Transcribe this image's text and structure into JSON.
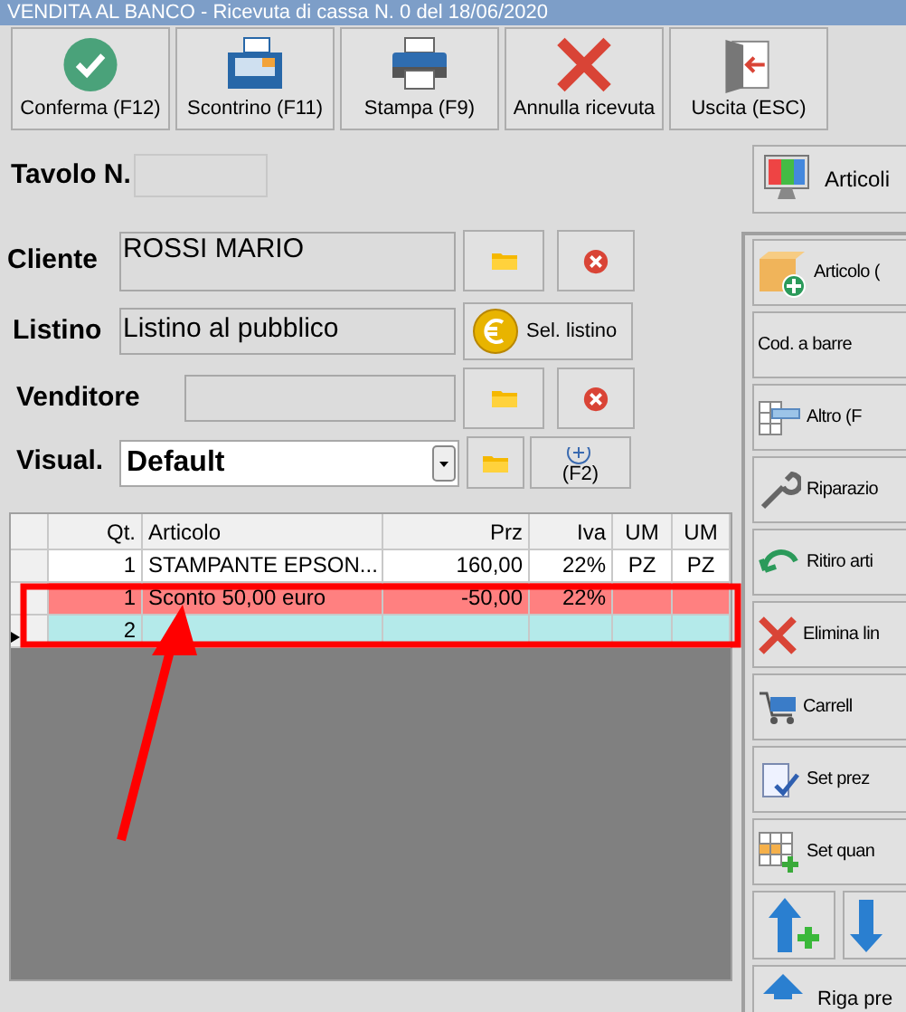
{
  "window": {
    "title": "VENDITA AL BANCO - Ricevuta di cassa N. 0 del 18/06/2020"
  },
  "toolbar": [
    {
      "label": "Conferma (F12)"
    },
    {
      "label": "Scontrino (F11)"
    },
    {
      "label": "Stampa (F9)"
    },
    {
      "label": "Annulla ricevuta"
    },
    {
      "label": "Uscita (ESC)"
    }
  ],
  "form": {
    "tavolo": {
      "label": "Tavolo N."
    },
    "cliente": {
      "label": "Cliente",
      "value": "ROSSI MARIO"
    },
    "listino": {
      "label": "Listino",
      "value": "Listino al pubblico",
      "button": "Sel. listino"
    },
    "venditore": {
      "label": "Venditore"
    },
    "visual": {
      "label": "Visual.",
      "value": "Default",
      "button": "(F2)"
    }
  },
  "table": {
    "columns": [
      "Qt.",
      "Articolo",
      "Prz",
      "Iva",
      "UM",
      "UM"
    ],
    "rows": [
      {
        "selected": false,
        "color": "#ffffff",
        "cells": [
          "1",
          "STAMPANTE EPSON...",
          "160,00",
          "22%",
          "PZ",
          "PZ"
        ]
      },
      {
        "selected": false,
        "color": "#ff8080",
        "cells": [
          "1",
          "Sconto 50,00 euro",
          "-50,00",
          "22%",
          "",
          ""
        ]
      },
      {
        "selected": true,
        "color": "#b4eaea",
        "cells": [
          "2",
          "",
          "",
          "",
          "",
          ""
        ]
      }
    ]
  },
  "side": {
    "top_button": "Articoli",
    "buttons": [
      {
        "label": "Articolo ("
      },
      {
        "label": "Cod. a barre"
      },
      {
        "label": "Altro (F"
      },
      {
        "label": "Riparazio"
      },
      {
        "label": "Ritiro arti"
      },
      {
        "label": "Elimina lin"
      },
      {
        "label": "Carrell"
      },
      {
        "label": "Set prez"
      },
      {
        "label": "Set quan"
      }
    ],
    "bottom_button": "Riga pre"
  }
}
